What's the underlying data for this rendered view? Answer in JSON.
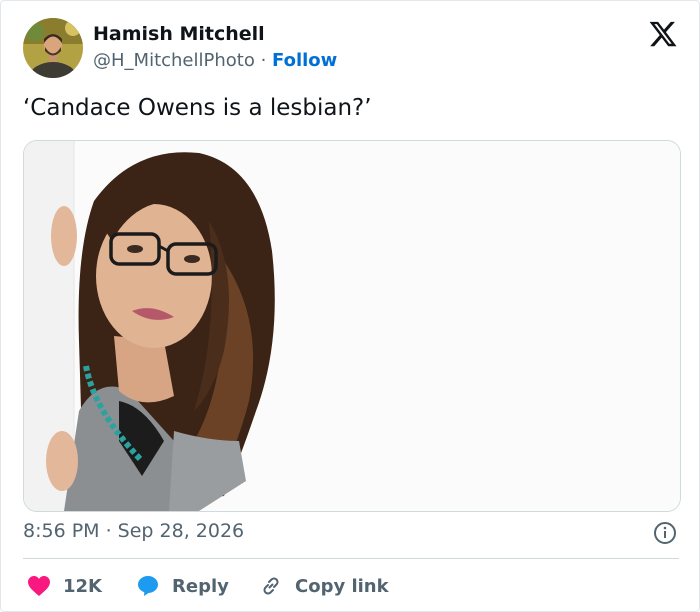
{
  "tweet": {
    "author_name": "Hamish Mitchell",
    "handle": "@H_MitchellPhoto",
    "separator": " · ",
    "follow_label": "Follow",
    "text": "‘Candace Owens is a lesbian?’",
    "timestamp": "8:56 PM · Sep 28, 2026",
    "actions": {
      "likes": "12K",
      "reply": "Reply",
      "copy_link": "Copy link"
    }
  },
  "colors": {
    "follow": "#006fd6",
    "like_heart": "#f91880",
    "reply_bubble": "#1d9bf0",
    "muted_text": "#536471"
  },
  "icons": [
    "x-logo-icon",
    "info-icon",
    "heart-icon",
    "reply-bubble-icon",
    "link-icon"
  ]
}
